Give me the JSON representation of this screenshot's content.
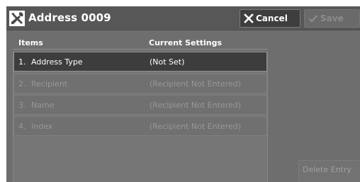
{
  "window": {
    "title": "Address 0009",
    "title_icon": "tools-icon"
  },
  "toolbar": {
    "cancel_label": "Cancel",
    "cancel_icon": "close-icon",
    "save_label": "Save",
    "save_icon": "checkmark-icon"
  },
  "table": {
    "headers": {
      "items": "Items",
      "settings": "Current Settings"
    },
    "rows": [
      {
        "num": "1.",
        "label": "Address Type",
        "value": "(Not Set)",
        "state": "selected"
      },
      {
        "num": "2.",
        "label": "Recipient",
        "value": "(Recipient Not Entered)",
        "state": "disabled"
      },
      {
        "num": "3.",
        "label": "Name",
        "value": "(Recipient Not Entered)",
        "state": "disabled"
      },
      {
        "num": "4.",
        "label": "Index",
        "value": "(Recipient Not Entered)",
        "state": "disabled"
      }
    ]
  },
  "actions": {
    "delete_label": "Delete Entry"
  },
  "colors": {
    "panel_bg": "#6e6e6e",
    "titlebar_bg": "#575757",
    "selected_row_bg": "#3d3d3d",
    "disabled_text": "#979797"
  }
}
